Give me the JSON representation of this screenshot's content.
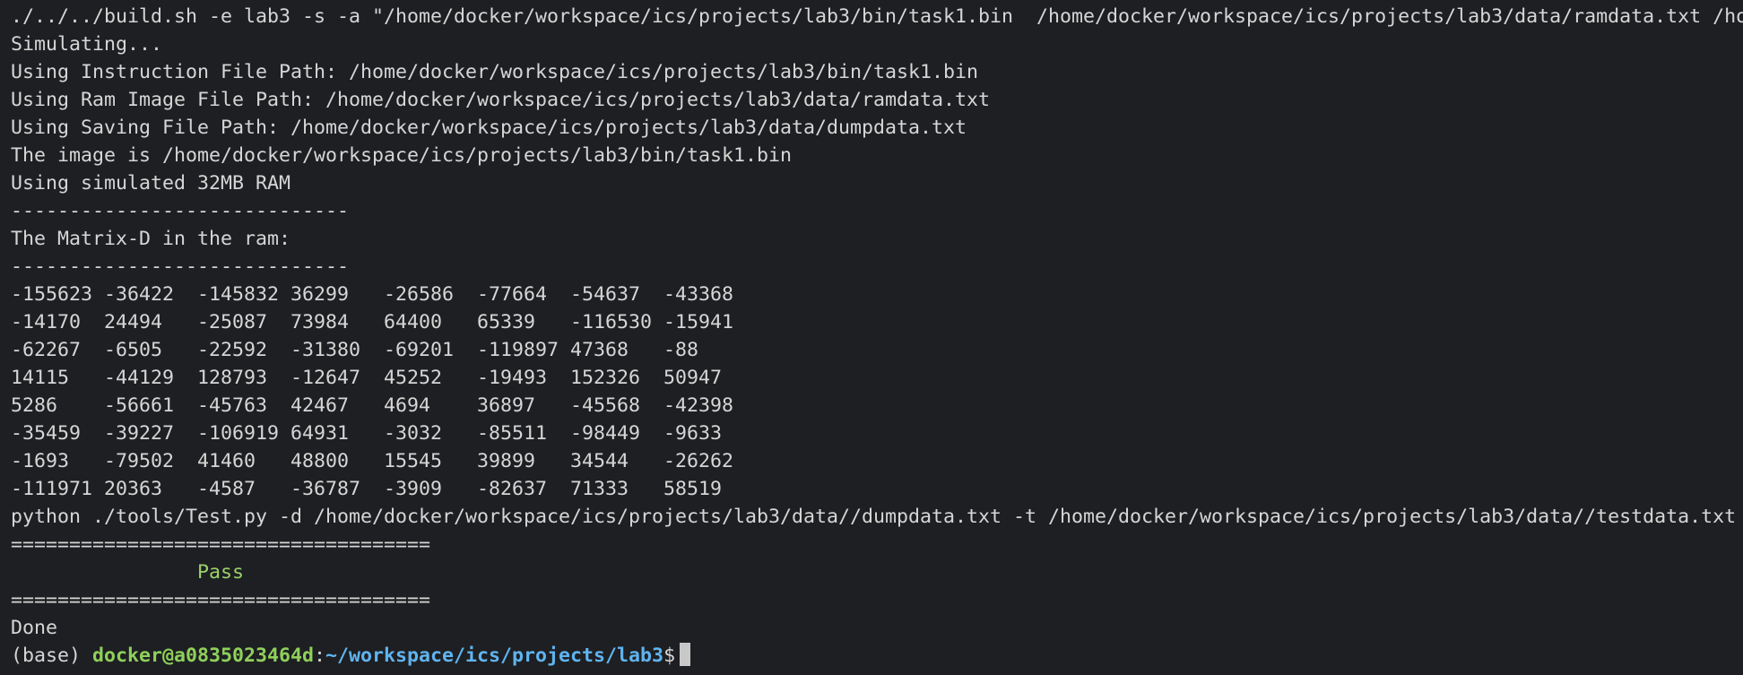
{
  "terminal": {
    "command": "./../../build.sh -e lab3 -s -a \"/home/docker/workspace/ics/projects/lab3/bin/task1.bin  /home/docker/workspace/ics/projects/lab3/data/ramdata.txt /ho",
    "simulating": "Simulating...",
    "instruction_path": "Using Instruction File Path: /home/docker/workspace/ics/projects/lab3/bin/task1.bin",
    "ram_image_path": "Using Ram Image File Path: /home/docker/workspace/ics/projects/lab3/data/ramdata.txt",
    "saving_path": "Using Saving File Path: /home/docker/workspace/ics/projects/lab3/data/dumpdata.txt",
    "image_is": "The image is /home/docker/workspace/ics/projects/lab3/bin/task1.bin",
    "ram_size": "Using simulated 32MB RAM",
    "separator_dash": "-----------------------------",
    "matrix_title": "The Matrix-D in the ram:",
    "matrix_rows": [
      "-155623 -36422  -145832 36299   -26586  -77664  -54637  -43368",
      "-14170  24494   -25087  73984   64400   65339   -116530 -15941",
      "-62267  -6505   -22592  -31380  -69201  -119897 47368   -88",
      "14115   -44129  128793  -12647  45252   -19493  152326  50947",
      "5286    -56661  -45763  42467   4694    36897   -45568  -42398",
      "-35459  -39227  -106919 64931   -3032   -85511  -98449  -9633",
      "-1693   -79502  41460   48800   15545   39899   34544   -26262",
      "-111971 20363   -4587   -36787  -3909   -82637  71333   58519"
    ],
    "test_command": "python ./tools/Test.py -d /home/docker/workspace/ics/projects/lab3/data//dumpdata.txt -t /home/docker/workspace/ics/projects/lab3/data//testdata.txt",
    "separator_equals": "====================================",
    "pass_indent": "                ",
    "pass_text": "Pass",
    "done": "Done",
    "prompt": {
      "env": "(base) ",
      "user_host": "docker@a0835023464d",
      "colon": ":",
      "path": "~/workspace/ics/projects/lab3",
      "symbol": "$"
    },
    "colors": {
      "background": "#1e1f22",
      "text": "#d6d6d6",
      "pass": "#9ad26a",
      "user_host": "#8fd05b",
      "path": "#5fb4f0"
    }
  }
}
